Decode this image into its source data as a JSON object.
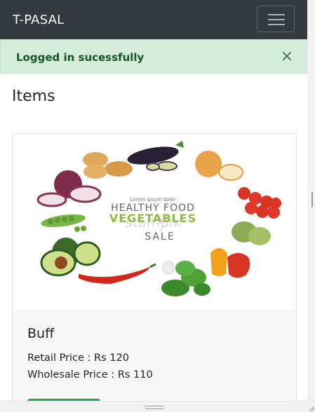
{
  "navbar": {
    "brand": "T-PASAL",
    "menu_icon": "hamburger-menu-icon"
  },
  "alert": {
    "message": "Logged in sucessfully",
    "close_icon": "close-icon",
    "close_symbol": "×"
  },
  "page": {
    "heading": "Items"
  },
  "items": [
    {
      "name": "Buff",
      "retail_price": "Retail Price : Rs 120",
      "wholesale_price": "Wholesale Price : Rs 110",
      "image": {
        "small_text": "Lorem ipsum dolor",
        "line1": "HEALTHY FOOD",
        "line2": "VEGETABLES",
        "line3": "SALE",
        "watermark": "stampik"
      }
    }
  ],
  "colors": {
    "navbar": "#343a40",
    "alert_bg": "#d4edda",
    "alert_text": "#155724",
    "button": "#28a745"
  }
}
